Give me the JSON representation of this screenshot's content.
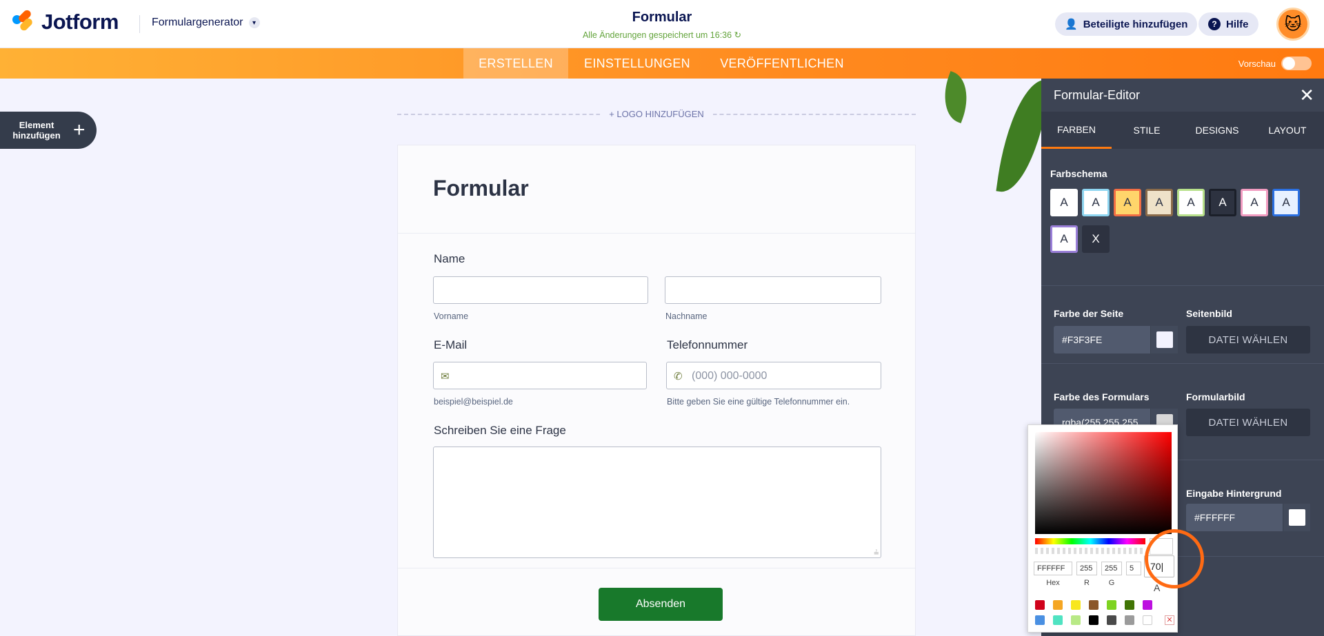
{
  "header": {
    "brand": "Jotform",
    "generator": "Formulargenerator",
    "doc_title": "Formular",
    "saved_status": "Alle Änderungen gespeichert um 16:36",
    "add_participants": "Beteiligte hinzufügen",
    "help": "Hilfe"
  },
  "nav": {
    "tabs": [
      "ERSTELLEN",
      "EINSTELLUNGEN",
      "VERÖFFENTLICHEN"
    ],
    "active": "ERSTELLEN",
    "preview_label": "Vorschau"
  },
  "sidebar": {
    "add_element": "Element hinzufügen"
  },
  "form": {
    "add_logo": "+ LOGO HINZUFÜGEN",
    "title": "Formular",
    "name_label": "Name",
    "first_name_sub": "Vorname",
    "last_name_sub": "Nachname",
    "email_label": "E-Mail",
    "email_sub": "beispiel@beispiel.de",
    "phone_label": "Telefonnummer",
    "phone_placeholder": "(000) 000-0000",
    "phone_sub": "Bitte geben Sie eine gültige Telefonnummer ein.",
    "question_label": "Schreiben Sie eine Frage",
    "submit": "Absenden"
  },
  "editor": {
    "title": "Formular-Editor",
    "tabs": [
      "FARBEN",
      "STILE",
      "DESIGNS",
      "LAYOUT"
    ],
    "active_tab": "FARBEN",
    "scheme_label": "Farbschema",
    "schemes": [
      {
        "letter": "A",
        "bg": "#ffffff",
        "border": "#ffffff",
        "fg": "#2c3345"
      },
      {
        "letter": "A",
        "bg": "#ffffff",
        "border": "#8ed5f0",
        "fg": "#2c3345"
      },
      {
        "letter": "A",
        "bg": "#ffd56b",
        "border": "#f06d44",
        "fg": "#2c3345"
      },
      {
        "letter": "A",
        "bg": "#efe2c9",
        "border": "#8a6b4a",
        "fg": "#2c3345"
      },
      {
        "letter": "A",
        "bg": "#ffffff",
        "border": "#b7e08a",
        "fg": "#2c3345"
      },
      {
        "letter": "A",
        "bg": "#2d3240",
        "border": "#1b1f29",
        "fg": "#ffffff"
      },
      {
        "letter": "A",
        "bg": "#ffffff",
        "border": "#f19bc0",
        "fg": "#2c3345"
      },
      {
        "letter": "A",
        "bg": "#e8f1ff",
        "border": "#2b6fe0",
        "fg": "#2c3345"
      },
      {
        "letter": "A",
        "bg": "#ffffff",
        "border": "#9a7fd8",
        "fg": "#2c3345"
      },
      {
        "letter": "X",
        "bg": "#2d3240",
        "border": "#2d3240",
        "fg": "#ffffff"
      }
    ],
    "page_color_label": "Farbe der Seite",
    "page_color_value": "#F3F3FE",
    "page_image_label": "Seitenbild",
    "choose_file": "DATEI WÄHLEN",
    "form_color_label": "Farbe des Formulars",
    "form_color_value": "rgba(255,255,255,",
    "form_image_label": "Formularbild",
    "input_bg_label": "Eingabe Hintergrund",
    "input_bg_value": "#FFFFFF"
  },
  "picker": {
    "hex": "FFFFFF",
    "r": "255",
    "g": "255",
    "b_partial": "5",
    "alpha": "70",
    "labels": {
      "hex": "Hex",
      "r": "R",
      "g": "G",
      "a": "A"
    },
    "palette": [
      "#d0021b",
      "#f5a623",
      "#f8e71c",
      "#8b572a",
      "#7ed321",
      "#417505",
      "#bd10e0",
      "#4a90e2",
      "#50e3c2",
      "#b8e986",
      "#000000",
      "#4a4a4a",
      "#9b9b9b",
      "#ffffff"
    ]
  },
  "colors": {
    "brand_orange": "#ff7a10",
    "panel_bg": "#3d4454",
    "submit_green": "#18792b",
    "saved_green": "#62a33a"
  }
}
